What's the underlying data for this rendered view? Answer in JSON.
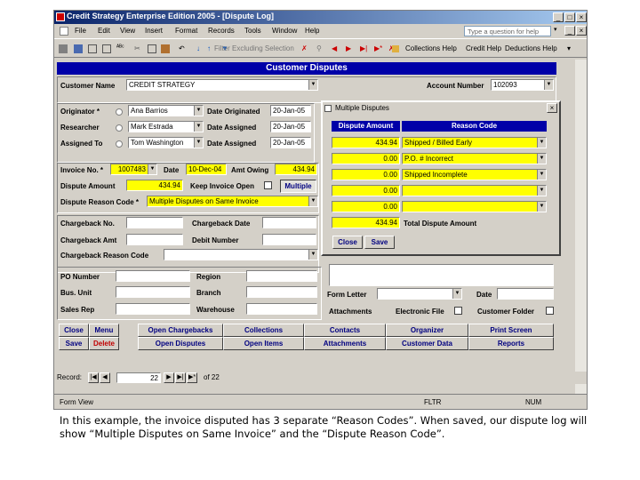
{
  "window": {
    "title": "Credit Strategy Enterprise Edition 2005 - [Dispute Log]",
    "min": "_",
    "max": "□",
    "close": "×"
  },
  "menu": [
    "File",
    "Edit",
    "View",
    "Insert",
    "Format",
    "Records",
    "Tools",
    "Window",
    "Help"
  ],
  "help_placeholder": "Type a question for help",
  "toolbar": {
    "filter_label": "Filter Excluding Selection",
    "collections_help": "Collections Help",
    "credit_help": "Credit Help",
    "deductions_help": "Deductions Help"
  },
  "form": {
    "header": "Customer Disputes",
    "customer_name_label": "Customer Name",
    "customer_name": "CREDIT STRATEGY",
    "account_number_label": "Account Number",
    "account_number": "102093",
    "originator_label": "Originator *",
    "originator": "Ana Barrios",
    "date_originated_label": "Date Originated",
    "date_originated": "20-Jan-05",
    "researcher_label": "Researcher",
    "researcher": "Mark Estrada",
    "researcher_date_label": "Date Assigned",
    "researcher_date": "20-Jan-05",
    "assigned_to_label": "Assigned To",
    "assigned_to": "Tom Washington",
    "assigned_date_label": "Date Assigned",
    "assigned_date": "20-Jan-05",
    "invoice_no_label": "Invoice No. *",
    "invoice_no": "1007483",
    "date_label": "Date",
    "invoice_date": "10-Dec-04",
    "amt_owing_label": "Amt Owing",
    "amt_owing": "434.94",
    "dispute_amount_label": "Dispute Amount",
    "dispute_amount": "434.94",
    "keep_invoice_open_label": "Keep Invoice Open",
    "multiple_button": "Multiple",
    "dispute_reason_label": "Dispute Reason Code *",
    "dispute_reason": "Multiple Disputes on Same Invoice",
    "chargeback_no_label": "Chargeback No.",
    "chargeback_date_label": "Chargeback Date",
    "chargeback_amt_label": "Chargeback Amt",
    "debit_number_label": "Debit Number",
    "chargeback_reason_label": "Chargeback Reason Code",
    "po_number_label": "PO Number",
    "region_label": "Region",
    "bus_unit_label": "Bus. Unit",
    "branch_label": "Branch",
    "sales_rep_label": "Sales Rep",
    "warehouse_label": "Warehouse",
    "form_letter_label": "Form Letter",
    "form_letter_date_label": "Date",
    "attachments_label": "Attachments",
    "electronic_file_label": "Electronic File",
    "customer_folder_label": "Customer Folder"
  },
  "buttons": {
    "close": "Close",
    "menu": "Menu",
    "save": "Save",
    "delete": "Delete",
    "open_chargebacks": "Open Chargebacks",
    "collections": "Collections",
    "contacts": "Contacts",
    "organizer": "Organizer",
    "print_screen": "Print Screen",
    "open_disputes": "Open Disputes",
    "open_items": "Open Items",
    "attachments": "Attachments",
    "customer_data": "Customer Data",
    "reports": "Reports"
  },
  "dialog": {
    "title": "Multiple Disputes",
    "col_amount": "Dispute Amount",
    "col_reason": "Reason Code",
    "rows": [
      {
        "amount": "434.94",
        "reason": "Shipped / Billed Early"
      },
      {
        "amount": "0.00",
        "reason": "P.O. # Incorrect"
      },
      {
        "amount": "0.00",
        "reason": "Shipped Incomplete"
      },
      {
        "amount": "0.00",
        "reason": ""
      },
      {
        "amount": "0.00",
        "reason": ""
      }
    ],
    "total_amount": "434.94",
    "total_label": "Total Dispute Amount",
    "close": "Close",
    "save": "Save",
    "close_x": "×"
  },
  "record_nav": {
    "label": "Record:",
    "current": "22",
    "of_label": "of 22"
  },
  "status": {
    "view": "Form View",
    "fltr": "FLTR",
    "num": "NUM"
  },
  "caption": "In this example, the invoice disputed has 3 separate “Reason Codes”. When saved, our dispute log will show “Multiple Disputes on Same Invoice” and the “Dispute Reason Code”."
}
